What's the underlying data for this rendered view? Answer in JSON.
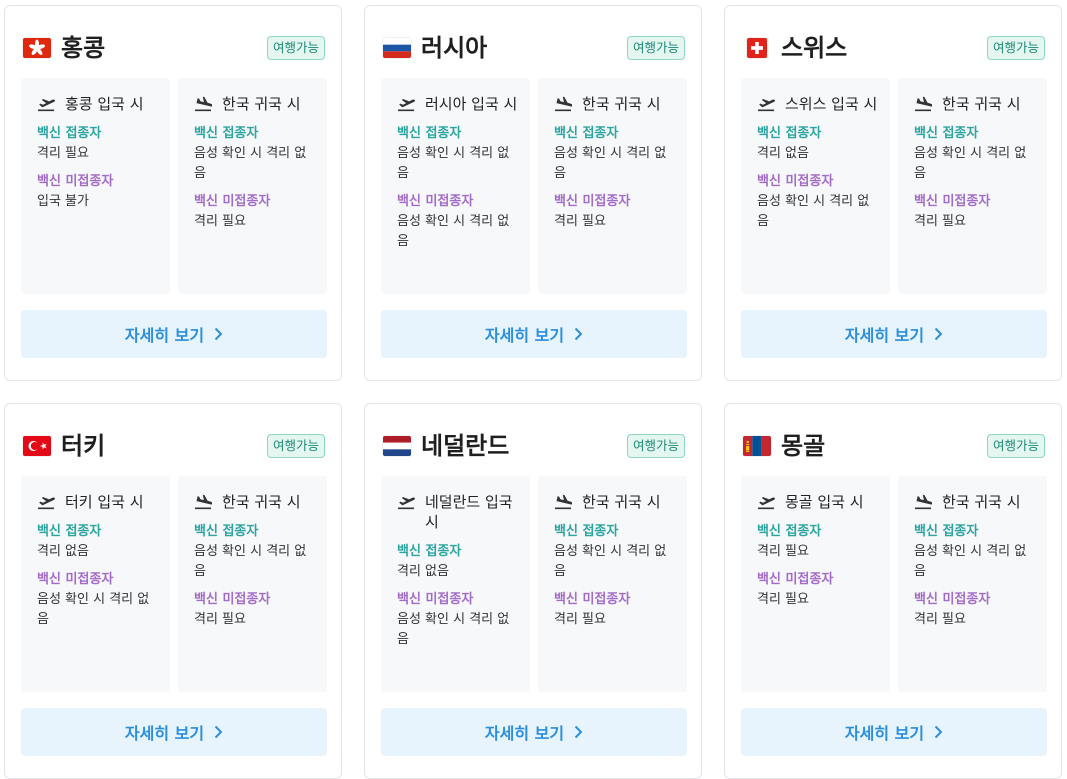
{
  "badge_label": "여행가능",
  "detail_label": "자세히 보기",
  "vaccinated_label": "백신 접종자",
  "unvaccinated_label": "백신 미접종자",
  "return_title": "한국 귀국 시",
  "colors": {
    "badge_text": "#1d8a76",
    "vaccinated": "#2aa5a0",
    "unvaccinated": "#a36cc8",
    "button_text": "#2b8fde"
  },
  "cards": [
    {
      "country": "홍콩",
      "flag": "hong-kong-flag-icon",
      "entry": {
        "title": "홍콩 입국 시",
        "vaccinated": "격리 필요",
        "unvaccinated": "입국 불가"
      },
      "return": {
        "vaccinated": "음성 확인 시 격리 없음",
        "unvaccinated": "격리 필요"
      }
    },
    {
      "country": "러시아",
      "flag": "russia-flag-icon",
      "entry": {
        "title": "러시아 입국 시",
        "vaccinated": "음성 확인 시 격리 없음",
        "unvaccinated": "음성 확인 시 격리 없음"
      },
      "return": {
        "vaccinated": "음성 확인 시 격리 없음",
        "unvaccinated": "격리 필요"
      }
    },
    {
      "country": "스위스",
      "flag": "switzerland-flag-icon",
      "entry": {
        "title": "스위스 입국 시",
        "vaccinated": "격리 없음",
        "unvaccinated": "음성 확인 시 격리 없음"
      },
      "return": {
        "vaccinated": "음성 확인 시 격리 없음",
        "unvaccinated": "격리 필요"
      }
    },
    {
      "country": "터키",
      "flag": "turkey-flag-icon",
      "entry": {
        "title": "터키 입국 시",
        "vaccinated": "격리 없음",
        "unvaccinated": "음성 확인 시 격리 없음"
      },
      "return": {
        "vaccinated": "음성 확인 시 격리 없음",
        "unvaccinated": "격리 필요"
      }
    },
    {
      "country": "네덜란드",
      "flag": "netherlands-flag-icon",
      "entry": {
        "title": "네덜란드 입국 시",
        "vaccinated": "격리 없음",
        "unvaccinated": "음성 확인 시 격리 없음"
      },
      "return": {
        "vaccinated": "음성 확인 시 격리 없음",
        "unvaccinated": "격리 필요"
      }
    },
    {
      "country": "몽골",
      "flag": "mongolia-flag-icon",
      "entry": {
        "title": "몽골 입국 시",
        "vaccinated": "격리 필요",
        "unvaccinated": "격리 필요"
      },
      "return": {
        "vaccinated": "음성 확인 시 격리 없음",
        "unvaccinated": "격리 필요"
      }
    }
  ]
}
